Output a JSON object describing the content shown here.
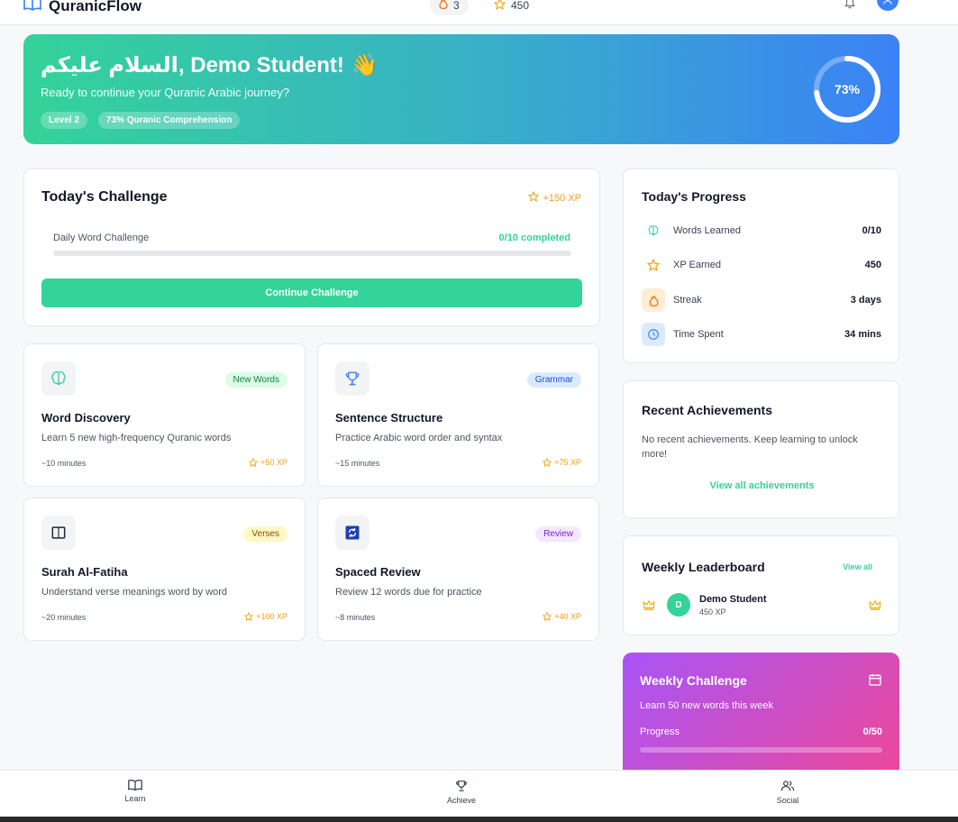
{
  "header": {
    "brand": "QuranicFlow",
    "streak_count": "3",
    "xp_count": "450"
  },
  "hero": {
    "greeting": "السلام عليكم, Demo Student!",
    "emoji": "👋",
    "subtitle": "Ready to continue your Quranic Arabic journey?",
    "chips": [
      "Level 2",
      "73% Quranic Comprehension"
    ],
    "percent_label": "73%",
    "percent_value": 73
  },
  "challenge": {
    "title": "Today's Challenge",
    "xp": "+150 XP",
    "label": "Daily Word Challenge",
    "progress_text": "0/10 completed",
    "progress_fraction": 0,
    "button_label": "Continue Challenge"
  },
  "activities": [
    {
      "title": "Word Discovery",
      "badge": "New Words",
      "desc": "Learn 5 new high-frequency Quranic words",
      "time": "~10 minutes",
      "xp": "+50 XP",
      "icon": "brain-icon"
    },
    {
      "title": "Sentence Structure",
      "badge": "Grammar",
      "desc": "Practice Arabic word order and syntax",
      "time": "~15 minutes",
      "xp": "+75 XP",
      "icon": "trophy-icon"
    },
    {
      "title": "Surah Al-Fatiha",
      "badge": "Verses",
      "desc": "Understand verse meanings word by word",
      "time": "~20 minutes",
      "xp": "+100 XP",
      "icon": "book-icon"
    },
    {
      "title": "Spaced Review",
      "badge": "Review",
      "desc": "Review 12 words due for practice",
      "time": "~8 minutes",
      "xp": "+40 XP",
      "icon": "refresh-icon"
    }
  ],
  "progress": {
    "title": "Today's Progress",
    "rows": [
      {
        "label": "Words Learned",
        "value": "0/10",
        "icon": "brain-icon"
      },
      {
        "label": "XP Earned",
        "value": "450",
        "icon": "star-icon"
      },
      {
        "label": "Streak",
        "value": "3 days",
        "icon": "flame-icon"
      },
      {
        "label": "Time Spent",
        "value": "34 mins",
        "icon": "clock-icon"
      }
    ]
  },
  "achievements": {
    "title": "Recent Achievements",
    "empty": "No recent achievements. Keep learning to unlock more!",
    "link": "View all achievements"
  },
  "leaderboard": {
    "title": "Weekly Leaderboard",
    "view_all": "View all",
    "entry": {
      "initial": "D",
      "name": "Demo Student",
      "xp": "450 XP"
    }
  },
  "weekly": {
    "title": "Weekly Challenge",
    "desc": "Learn 50 new words this week",
    "progress_label": "Progress",
    "progress_value": "0/50",
    "progress_fraction": 0
  },
  "nav": {
    "learn": "Learn",
    "achieve": "Achieve",
    "social": "Social"
  },
  "colors": {
    "accent": "#34d399",
    "blue": "#3b82f6",
    "star": "#f59e0b",
    "purple": "#a855f7",
    "pink": "#ec4899"
  }
}
